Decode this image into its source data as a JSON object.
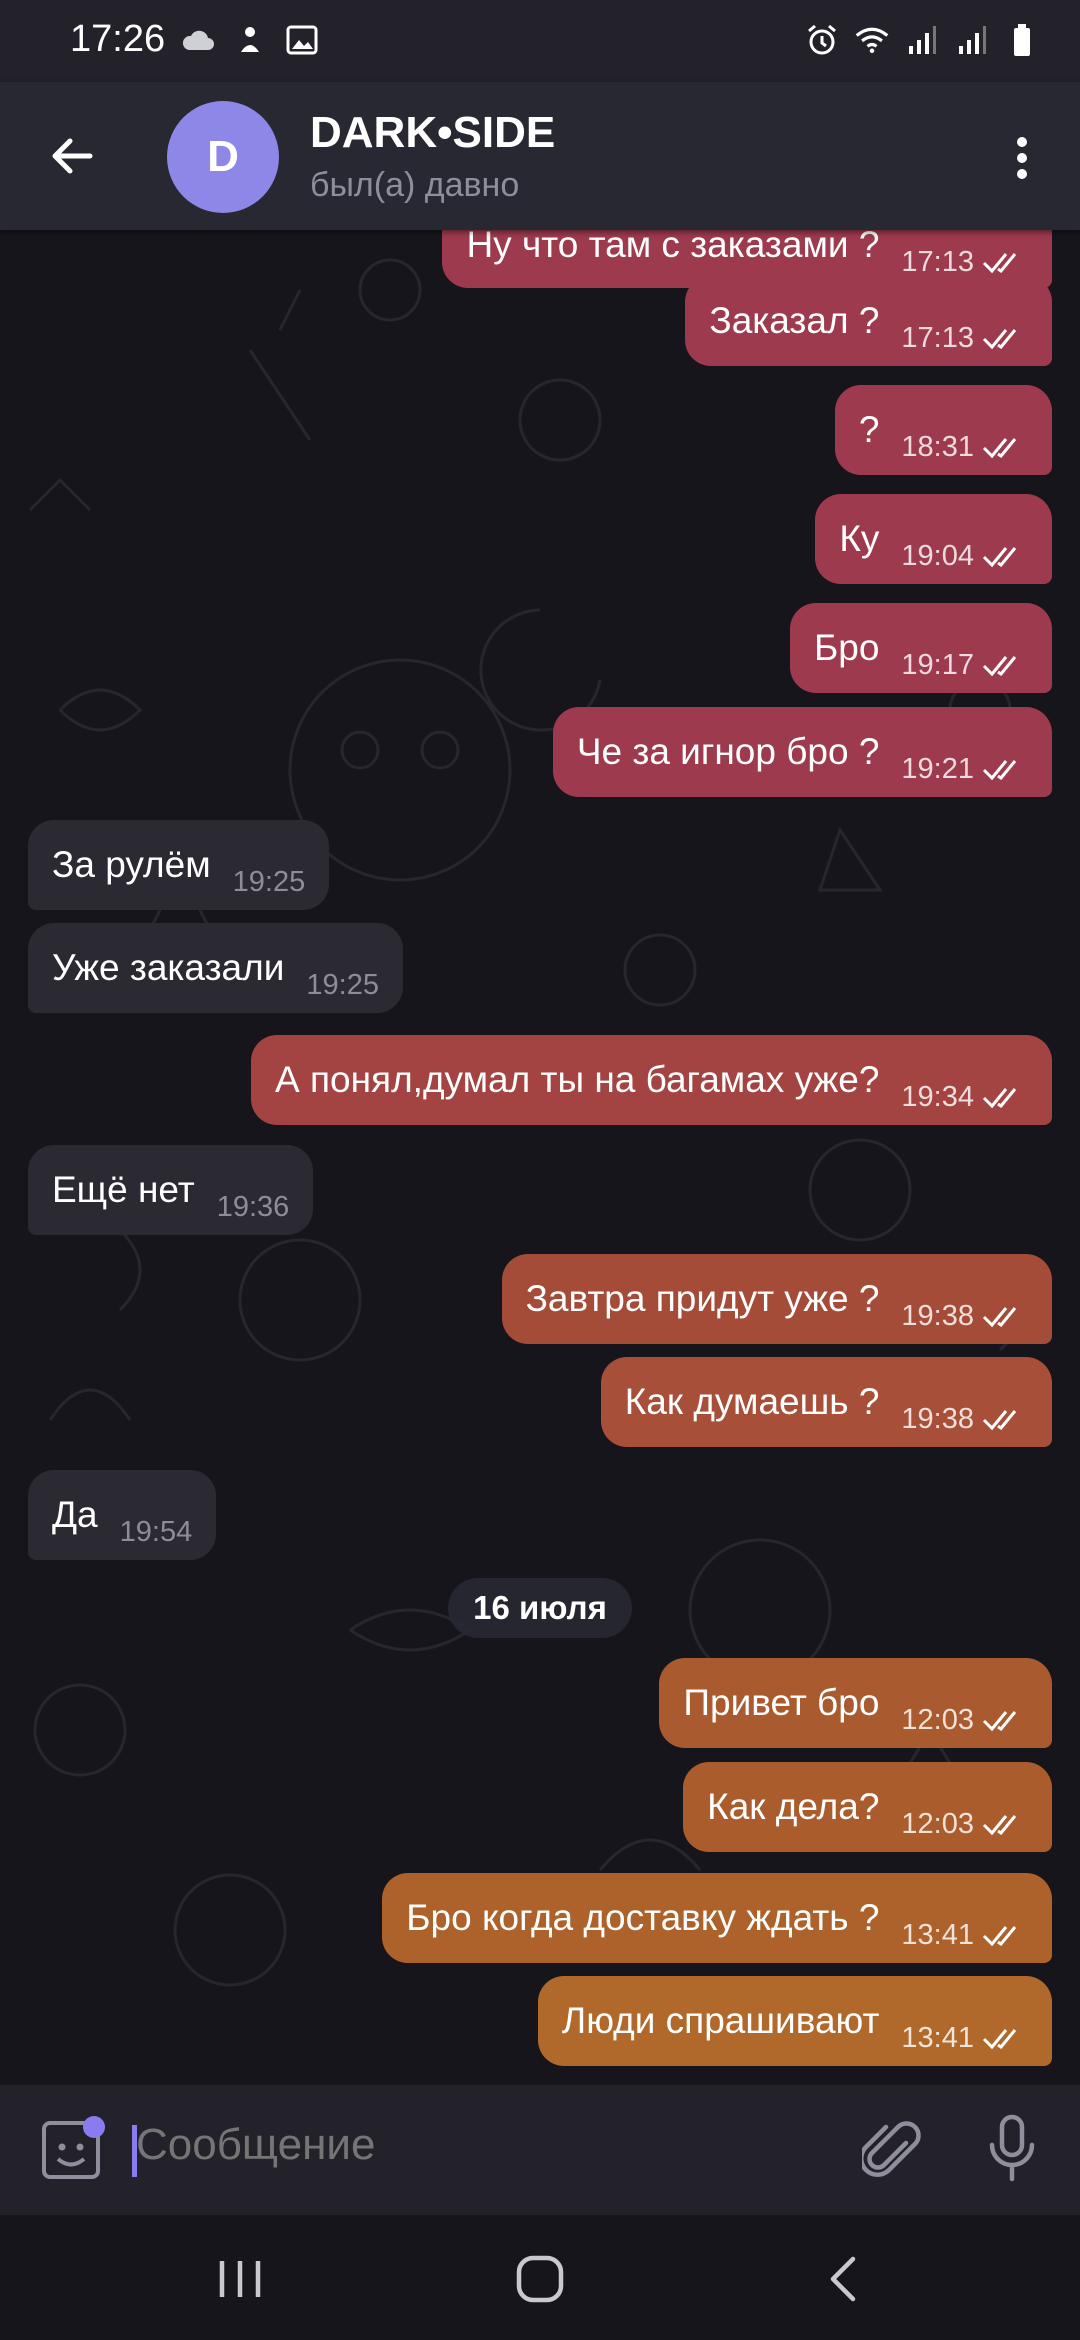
{
  "status_bar": {
    "time": "17:26"
  },
  "header": {
    "avatar_letter": "D",
    "title": "DARK•SIDE",
    "status": "был(а) давно"
  },
  "messages": [
    {
      "dir": "out",
      "text": "Ну что там с заказами ?",
      "time": "17:13",
      "color": "#9e3a4e"
    },
    {
      "dir": "out",
      "text": "Заказал ?",
      "time": "17:13",
      "color": "#9e3a4e"
    },
    {
      "dir": "out",
      "text": "?",
      "time": "18:31",
      "color": "#9e3a4e"
    },
    {
      "dir": "out",
      "text": "Ку",
      "time": "19:04",
      "color": "#9e3a4e"
    },
    {
      "dir": "out",
      "text": "Бро",
      "time": "19:17",
      "color": "#9e3a4e"
    },
    {
      "dir": "out",
      "text": "Че за игнор бро ?",
      "time": "19:21",
      "color": "#9e3a4e"
    },
    {
      "dir": "in",
      "text": "За рулём",
      "time": "19:25"
    },
    {
      "dir": "in",
      "text": "Уже заказали",
      "time": "19:25"
    },
    {
      "dir": "out",
      "text": "А понял,думал ты на багамах уже?",
      "time": "19:34",
      "color": "#a34442"
    },
    {
      "dir": "in",
      "text": "Ещё нет",
      "time": "19:36"
    },
    {
      "dir": "out",
      "text": "Завтра придут уже ?",
      "time": "19:38",
      "color": "#a54c39"
    },
    {
      "dir": "out",
      "text": "Как думаешь ?",
      "time": "19:38",
      "color": "#a74f38"
    },
    {
      "dir": "in",
      "text": "Да",
      "time": "19:54"
    },
    {
      "dir": "out",
      "text": "Привет бро",
      "time": "12:03",
      "color": "#a95a2e"
    },
    {
      "dir": "out",
      "text": "Как дела?",
      "time": "12:03",
      "color": "#aa5c2d"
    },
    {
      "dir": "out",
      "text": "Бро когда доставку ждать ?",
      "time": "13:41",
      "color": "#ad622b"
    },
    {
      "dir": "out",
      "text": "Люди спрашивают",
      "time": "13:41",
      "color": "#b0692a"
    }
  ],
  "date_separator": "16 июля",
  "input": {
    "placeholder": "Сообщение"
  },
  "icons": {
    "status_left": [
      "cloud-icon",
      "notification-icon",
      "gallery-icon"
    ],
    "status_right": [
      "alarm-icon",
      "wifi-icon",
      "signal-icon",
      "signal-icon",
      "battery-icon"
    ],
    "header": [
      "back-arrow-icon",
      "more-vertical-icon"
    ],
    "input": [
      "sticker-icon",
      "paperclip-icon",
      "microphone-icon"
    ],
    "nav": [
      "recent-apps-icon",
      "home-icon",
      "back-icon"
    ]
  }
}
